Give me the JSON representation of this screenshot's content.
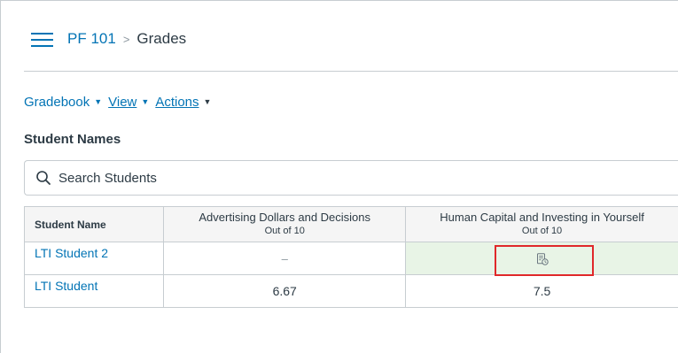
{
  "breadcrumb": {
    "course": "PF 101",
    "separator": ">",
    "current": "Grades"
  },
  "menu": {
    "gradebook": "Gradebook",
    "view": "View",
    "actions": "Actions"
  },
  "student_names": {
    "heading": "Student Names",
    "search_placeholder": "Search Students"
  },
  "grid": {
    "student_header": "Student Name",
    "assignments": [
      {
        "title": "Advertising Dollars and Decisions",
        "out_of": "Out of 10"
      },
      {
        "title": "Human Capital and Investing in Yourself",
        "out_of": "Out of 10"
      }
    ],
    "rows": [
      {
        "student": "LTI Student 2",
        "grades": [
          "–",
          ""
        ],
        "icons": [
          "",
          "submission-pending-icon"
        ]
      },
      {
        "student": "LTI Student",
        "grades": [
          "6.67",
          "7.5"
        ]
      }
    ]
  },
  "colors": {
    "link": "#0374b5",
    "text": "#2d3b45",
    "border": "#c7cdd1",
    "highlight_cell": "#e8f4e6",
    "selection_frame": "#e0282a"
  }
}
